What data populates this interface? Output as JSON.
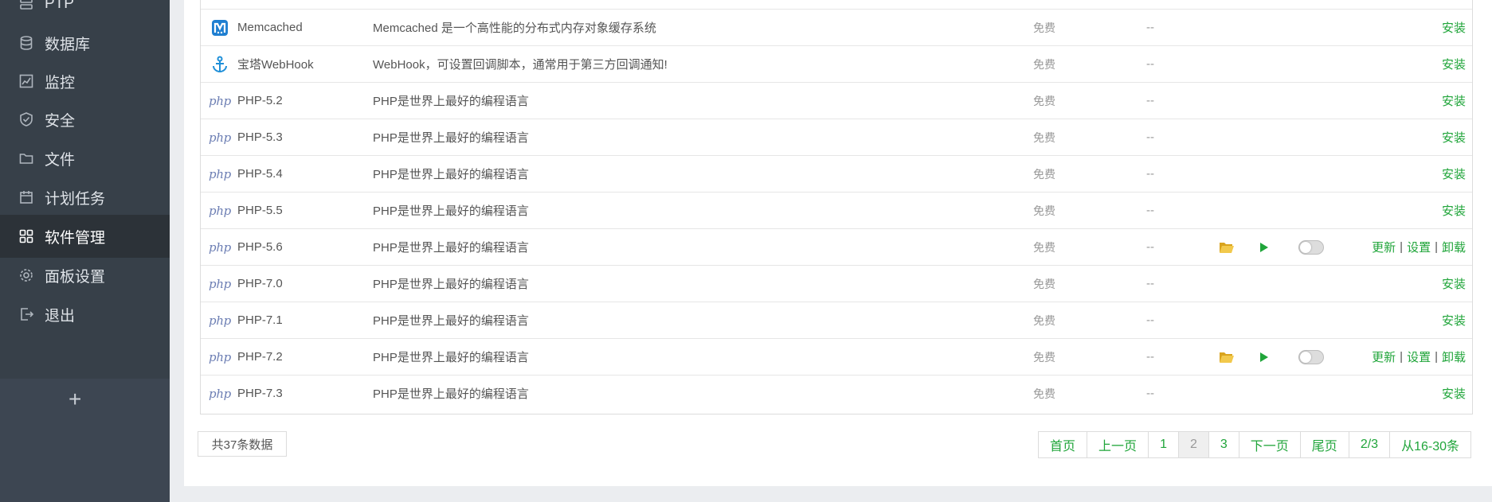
{
  "sidebar": {
    "items": [
      {
        "label": "PTP",
        "icon": "server-icon"
      },
      {
        "label": "数据库",
        "icon": "database-icon"
      },
      {
        "label": "监控",
        "icon": "monitor-icon"
      },
      {
        "label": "安全",
        "icon": "shield-icon"
      },
      {
        "label": "文件",
        "icon": "folder-icon"
      },
      {
        "label": "计划任务",
        "icon": "calendar-icon"
      },
      {
        "label": "软件管理",
        "icon": "grid-icon",
        "active": true
      },
      {
        "label": "面板设置",
        "icon": "gear-icon"
      },
      {
        "label": "退出",
        "icon": "logout-icon"
      }
    ],
    "add_label": "+"
  },
  "rows": [
    {
      "name": "Memcached",
      "desc": "Memcached 是一个高性能的分布式内存对象缓存系统",
      "price": "免费",
      "expire": "--",
      "icon": "memcached-icon",
      "installed": false
    },
    {
      "name": "宝塔WebHook",
      "desc": "WebHook，可设置回调脚本，通常用于第三方回调通知!",
      "price": "免费",
      "expire": "--",
      "icon": "anchor-icon",
      "installed": false
    },
    {
      "name": "PHP-5.2",
      "desc": "PHP是世界上最好的编程语言",
      "price": "免费",
      "expire": "--",
      "icon": "php-icon",
      "installed": false
    },
    {
      "name": "PHP-5.3",
      "desc": "PHP是世界上最好的编程语言",
      "price": "免费",
      "expire": "--",
      "icon": "php-icon",
      "installed": false
    },
    {
      "name": "PHP-5.4",
      "desc": "PHP是世界上最好的编程语言",
      "price": "免费",
      "expire": "--",
      "icon": "php-icon",
      "installed": false
    },
    {
      "name": "PHP-5.5",
      "desc": "PHP是世界上最好的编程语言",
      "price": "免费",
      "expire": "--",
      "icon": "php-icon",
      "installed": false
    },
    {
      "name": "PHP-5.6",
      "desc": "PHP是世界上最好的编程语言",
      "price": "免费",
      "expire": "--",
      "icon": "php-icon",
      "installed": true
    },
    {
      "name": "PHP-7.0",
      "desc": "PHP是世界上最好的编程语言",
      "price": "免费",
      "expire": "--",
      "icon": "php-icon",
      "installed": false
    },
    {
      "name": "PHP-7.1",
      "desc": "PHP是世界上最好的编程语言",
      "price": "免费",
      "expire": "--",
      "icon": "php-icon",
      "installed": false
    },
    {
      "name": "PHP-7.2",
      "desc": "PHP是世界上最好的编程语言",
      "price": "免费",
      "expire": "--",
      "icon": "php-icon",
      "installed": true
    },
    {
      "name": "PHP-7.3",
      "desc": "PHP是世界上最好的编程语言",
      "price": "免费",
      "expire": "--",
      "icon": "php-icon",
      "installed": false
    }
  ],
  "actions": {
    "install": "安装",
    "update": "更新",
    "settings": "设置",
    "uninstall": "卸载",
    "separator": "|",
    "php_logo_text": "php"
  },
  "footer": {
    "total": "共37条数据",
    "pager": [
      {
        "label": "首页",
        "name": "pager-first"
      },
      {
        "label": "上一页",
        "name": "pager-prev"
      },
      {
        "label": "1",
        "name": "pager-page-1"
      },
      {
        "label": "2",
        "name": "pager-page-2",
        "current": true
      },
      {
        "label": "3",
        "name": "pager-page-3"
      },
      {
        "label": "下一页",
        "name": "pager-next"
      },
      {
        "label": "尾页",
        "name": "pager-last"
      },
      {
        "label": "2/3",
        "name": "pager-page-count",
        "static": true
      },
      {
        "label": "从16-30条",
        "name": "pager-range",
        "static": true
      }
    ]
  },
  "colors": {
    "accent": "#20a53a",
    "sidebar": "#374049",
    "sidebar_active": "#2c3238",
    "folder": "#f0c040"
  }
}
